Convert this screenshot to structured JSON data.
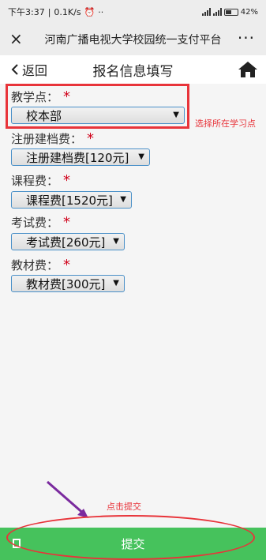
{
  "status": {
    "time": "下午3:37",
    "speed": "0.1K/s",
    "battery": "42%"
  },
  "titlebar": {
    "title": "河南广播电视大学校园统一支付平台",
    "close": "×",
    "more": "···"
  },
  "navbar": {
    "back": "返回",
    "title": "报名信息填写"
  },
  "fields": [
    {
      "label": "教学点：",
      "required": "*",
      "value": "校本部"
    },
    {
      "label": "注册建档费：",
      "required": "*",
      "value": "注册建档费[120元]"
    },
    {
      "label": "课程费：",
      "required": "*",
      "value": "课程费[1520元]"
    },
    {
      "label": "考试费：",
      "required": "*",
      "value": "考试费[260元]"
    },
    {
      "label": "教材费：",
      "required": "*",
      "value": "教材费[300元]"
    }
  ],
  "annotations": {
    "select_location": "选择所在学习点",
    "click_submit": "点击提交"
  },
  "submit": {
    "label": "提交"
  },
  "colors": {
    "accent": "#46c25c",
    "annotation": "#e8343a",
    "required": "#d0021b"
  }
}
